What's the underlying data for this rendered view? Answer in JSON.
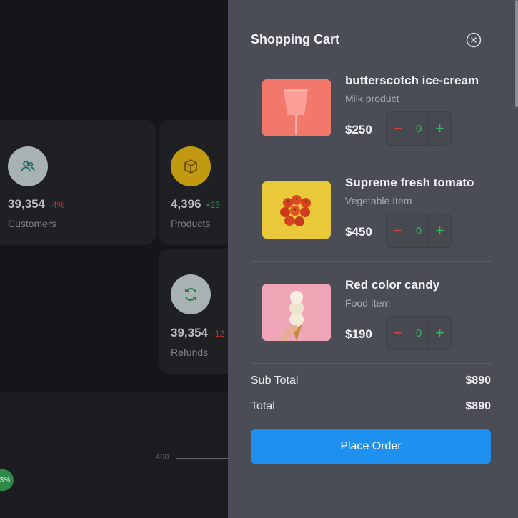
{
  "dashboard": {
    "stats": [
      {
        "value": "39,354",
        "change": "-4%",
        "label": "Customers",
        "icon": "users-icon"
      },
      {
        "value": "4,396",
        "change": "+23",
        "label": "Products",
        "icon": "box-icon"
      },
      {
        "value": "39,354",
        "change": "-12",
        "label": "Refunds",
        "icon": "refresh-icon"
      }
    ],
    "chart_axis_tick": "400",
    "pill_text": "3%"
  },
  "cart": {
    "title": "Shopping Cart",
    "close_icon": "close-circle-icon",
    "items": [
      {
        "name": "butterscotch ice-cream",
        "category": "Milk product",
        "price": "$250",
        "qty": "0",
        "image": "pink-cup-image"
      },
      {
        "name": "Supreme fresh tomato",
        "category": "Vegetable Item",
        "price": "$450",
        "qty": "0",
        "image": "tomato-image"
      },
      {
        "name": "Red color candy",
        "category": "Food Item",
        "price": "$190",
        "qty": "0",
        "image": "ice-cream-cone-image"
      }
    ],
    "subtotal_label": "Sub Total",
    "subtotal_value": "$890",
    "total_label": "Total",
    "total_value": "$890",
    "place_order_label": "Place Order",
    "minus_symbol": "−",
    "plus_symbol": "+"
  },
  "colors": {
    "accent": "#1e90f0",
    "panel": "#4a4d55",
    "negative": "#d4453d",
    "positive": "#3db063"
  }
}
